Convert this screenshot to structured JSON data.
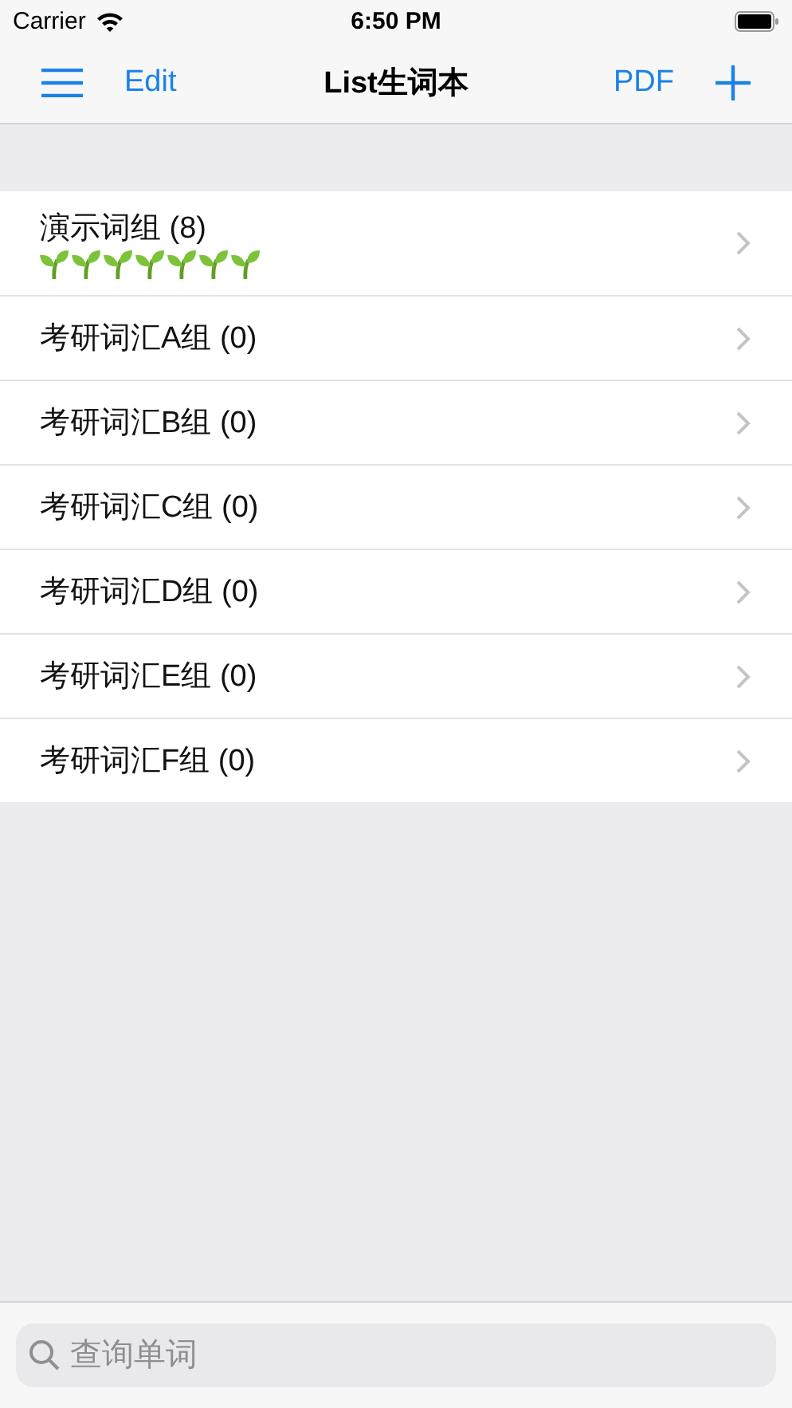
{
  "status_bar": {
    "carrier": "Carrier",
    "time": "6:50 PM"
  },
  "nav": {
    "edit": "Edit",
    "title": "List生词本",
    "pdf": "PDF"
  },
  "groups": [
    {
      "name": "演示词组 (8)",
      "icons": [
        {
          "kind": "sprout"
        },
        {
          "kind": "sprout"
        },
        {
          "kind": "sprout"
        },
        {
          "kind": "sprout"
        },
        {
          "kind": "sprout"
        },
        {
          "kind": "sprout"
        },
        {
          "kind": "sprout"
        }
      ]
    },
    {
      "name": "考研词汇A组 (0)"
    },
    {
      "name": "考研词汇B组 (0)"
    },
    {
      "name": "考研词汇C组 (0)"
    },
    {
      "name": "考研词汇D组 (0)"
    },
    {
      "name": "考研词汇E组 (0)"
    },
    {
      "name": "考研词汇F组 (0)"
    }
  ],
  "search": {
    "placeholder": "查询单词"
  }
}
